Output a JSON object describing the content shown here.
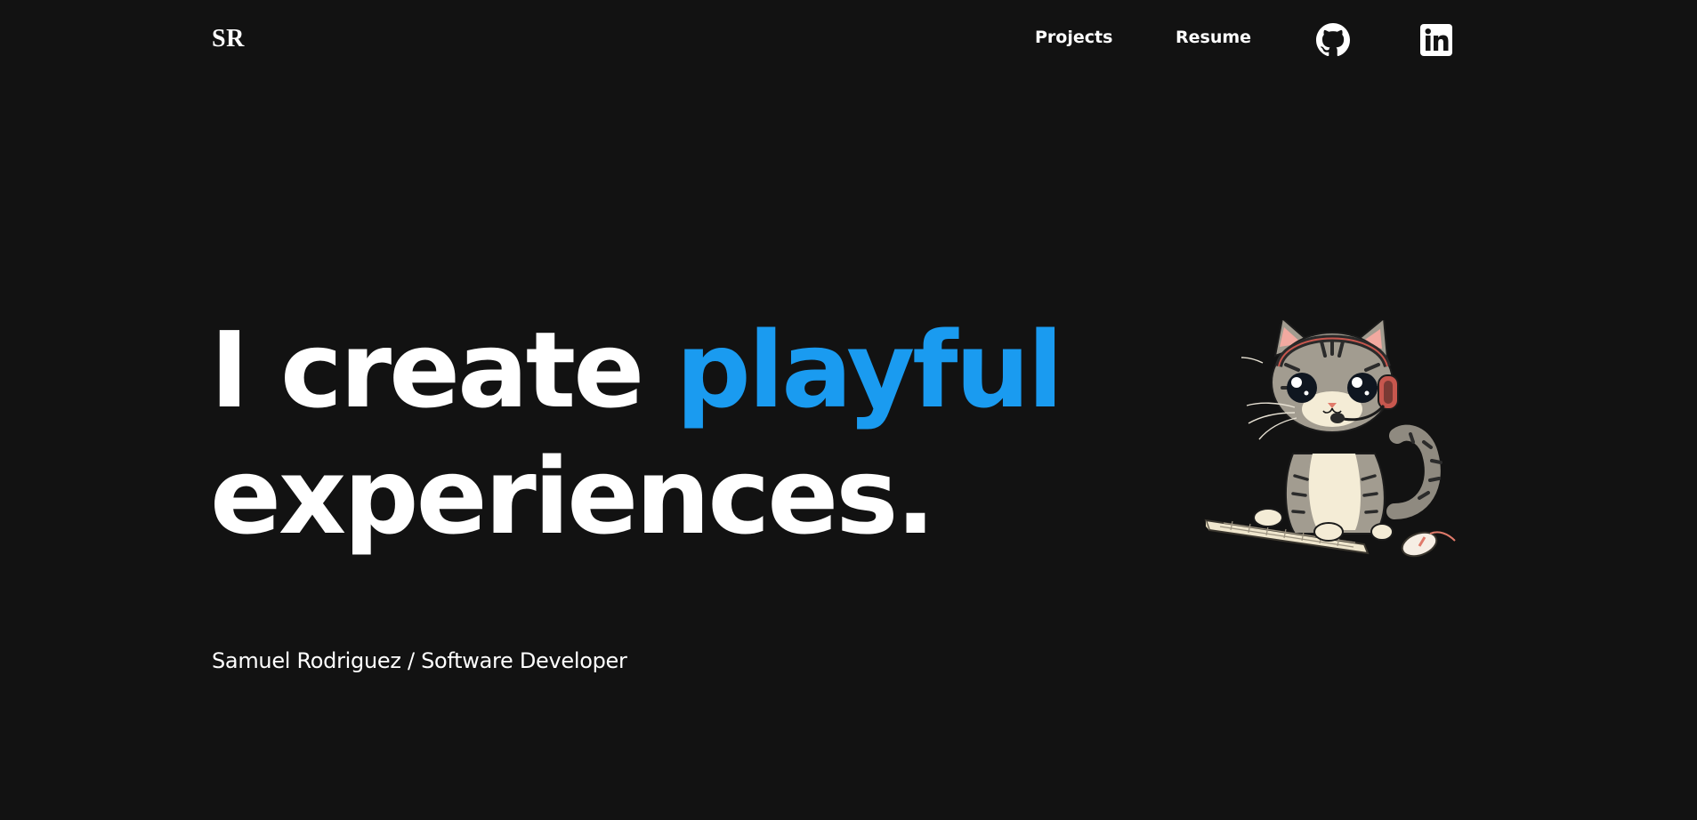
{
  "nav": {
    "logo": "SR",
    "links": [
      {
        "label": "Projects"
      },
      {
        "label": "Resume"
      }
    ],
    "icons": [
      {
        "name": "github-icon"
      },
      {
        "name": "linkedin-icon"
      }
    ]
  },
  "hero": {
    "line1_plain": "I create ",
    "line1_accent": "playful",
    "line2": "experiences.",
    "subtitle": "Samuel Rodriguez / Software Developer",
    "accent_color": "#1a9bf0",
    "illustration": "cat-with-headset-typing-on-keyboard"
  },
  "colors": {
    "background": "#121212",
    "text": "#ffffff",
    "accent": "#1a9bf0"
  }
}
